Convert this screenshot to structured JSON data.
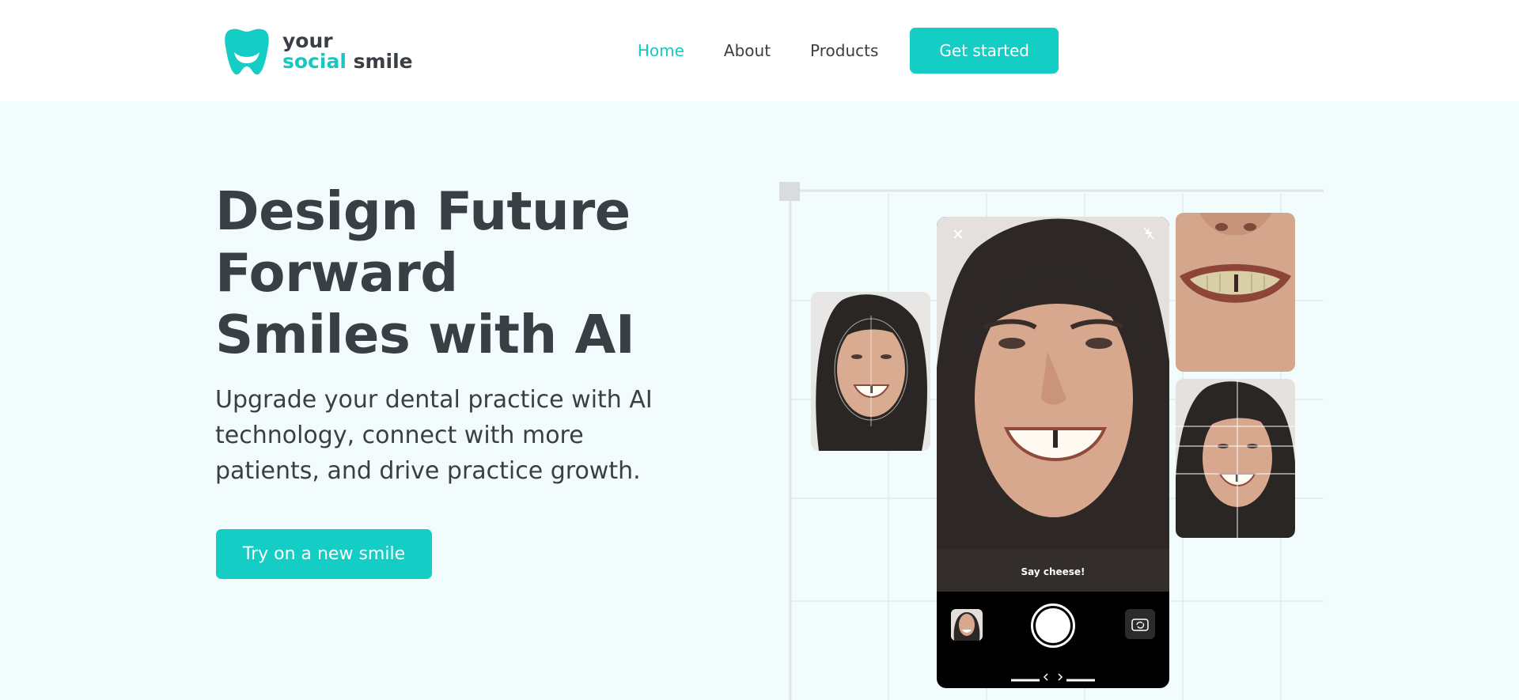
{
  "header": {
    "logo": {
      "line1": "your",
      "line2_accent": "social",
      "line2_rest": " smile"
    },
    "nav": {
      "home": "Home",
      "about": "About",
      "products": "Products",
      "cta": "Get started"
    }
  },
  "hero": {
    "title": "Design Future Forward Smiles with AI",
    "subtitle": "Upgrade your dental practice with AI technology, connect with more patients, and drive practice growth.",
    "button": "Try on a new smile"
  },
  "phone": {
    "caption": "Say cheese!",
    "icons": [
      "close-icon",
      "flash-off-icon",
      "gallery-thumbnail",
      "shutter-button",
      "camera-flip-icon",
      "chevron-left-icon",
      "chevron-right-icon"
    ]
  },
  "colors": {
    "accent": "#14cdc4",
    "text": "#3a3f45",
    "background": "#f3fcfc"
  }
}
